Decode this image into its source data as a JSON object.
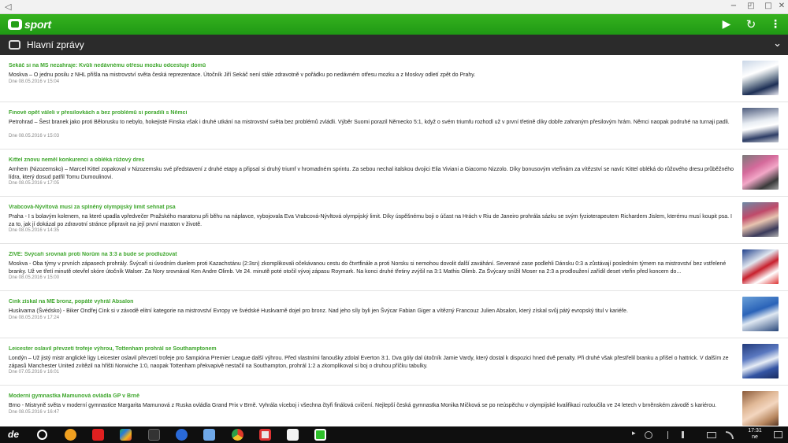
{
  "window": {
    "back": "◁",
    "minimize": "−",
    "maximize": "□",
    "restore": "◰",
    "close": "✕"
  },
  "app": {
    "logo_text": "sport",
    "play": "▶",
    "refresh": "↻",
    "menu": "⋮"
  },
  "section": {
    "title": "Hlavní zprávy",
    "chevron": "⌄"
  },
  "articles": [
    {
      "title": "Sekáč si na MS nezahraje: Kvůli nedávnému otřesu mozku odcestuje domů",
      "body": "Moskva – O jednu posilu z NHL přišla na mistrovství světa česká reprezentace. Útočník Jiří Sekáč není stále zdravotně v pořádku po nedávném otřesu mozku a z Moskvy odletí zpět do Prahy.",
      "date": "Dne 08.05.2016 v 15:04"
    },
    {
      "title": "Finové opět váleli v přesilovkách a bez problémů si poradili s Němci",
      "body": "Petrohrad – Šest branek jako proti Bělorusku to nebylo, hokejisté Finska však i druhé utkání na mistrovství světa bez problémů zvládli. Výběr Suomi porazil Německo 5:1, když o svém triumfu rozhodl už v první třetině díky dobře zahraným přesilovým hrám. Němci naopak podruhé na turnaji padli.",
      "date": "Dne 08.05.2016 v 15:03"
    },
    {
      "title": "Kittel znovu neměl konkurenci a obléká růžový dres",
      "body": "Arnhem (Nizozemsko) – Marcel Kittel zopakoval v Nizozemsku své představení z druhé etapy a připsal si druhý triumf v hromadném sprintu. Za sebou nechal italskou dvojici Elia Viviani a Giacomo Nizzolo. Díky bonusovým vteřinám za vítězství se navíc Kittel obléká do růžového dresu průběžného lídra, který dosud patřil Tomu Dumoulinovi.",
      "date": "Dne 08.05.2016 v 17:05"
    },
    {
      "title": "Vrabcová-Nývltová musí za splněný olympijský limit sehnat psa",
      "body": "Praha - I s bolavým kolenem, na které upadla vpředvečer Pražského maratonu při běhu na náplavce, vybojovala Eva Vrabcová-Nývltová olympijský limit. Díky úspěšnému boji o účast na Hrách v Riu de Janeiro prohrála sázku se svým fyzioterapeutem Richardem Jislem, kterému musí koupit psa. I za to, jak jí dokázal po zdravotní stránce připravit na její první maraton v životě.",
      "date": "Dne 08.05.2016 v 14:35"
    },
    {
      "title": "ŽIVĚ: Švýcaři srovnali proti Norům na 3:3 a bude se prodlužovat",
      "body": "Moskva - Oba týmy v prvních zápasech prohrály. Švýcaři si úvodním duelem proti Kazachstánu (2:3sn) zkomplikovali očekávanou cestu do čtvrtfinále a proti Norsku si nemohou dovolit další zaváhání. Severané zase podlehli Dánsku 0:3 a zůstávají posledním týmem na mistrovství bez vstřelené branky. Už ve třetí minutě otevřel skóre útočník Walser. Za Nory srovnával Ken Andre Olimb. Ve 24. minutě poté otočil vývoj zápasu Roymark. Na konci druhé třetiny zvýšil na 3:1 Mathis Olimb. Za Švýcary snížil Moser na 2:3 a prodloužení zařídil deset vteřin před koncem do...",
      "date": "Dne 08.05.2016 v 15:00"
    },
    {
      "title": "Cink získal na ME bronz, popáté vyhrál Absalon",
      "body": "Huskvarna (Švédsko) - Biker Ondřej Cink si v závodě elitní kategorie na mistrovství Evropy ve švédské Huskvarně dojel pro bronz. Nad jeho síly byli jen Švýcar Fabian Giger a vítězný Francouz Julien Absalon, který získal svůj pátý evropský titul v kariéře.",
      "date": "Dne 08.05.2016 v 17:24"
    },
    {
      "title": "Leicester oslavil převzetí trofeje výhrou, Tottenham prohrál se Southamptonem",
      "body": "Londýn – Už jistý mistr anglické ligy Leicester oslavil převzetí trofeje pro šampióna Premier League další výhrou. Před vlastními fanoušky zdolal Everton 3:1. Dva góly dal útočník Jamie Vardy, který dostal k dispozici hned dvě penalty. Při druhé však přestřelil branku a přišel o hattrick. V dalším ze zápasů Manchester United zvítězil na hřišti Norwiche 1:0, naopak Tottenham překvapivě nestačil na Southampton, prohrál 1:2 a zkomplikoval si boj o druhou příčku tabulky.",
      "date": "Dne 07.05.2016 v 16:01"
    },
    {
      "title": "Moderní gymnastka Mamunová ovládla GP v Brně",
      "body": "Brno - Mistryně světa v moderní gymnastice Margarita Mamunová z Ruska ovládla Grand Prix v Brně. Vyhrála víceboj i všechna čtyři finálová cvičení. Nejlepší česká gymnastka Monika Mičková se po neúspěchu v olympijské kvalifikaci rozloučila ve 24 letech v brněnském závodě s kariérou.",
      "date": "Dne 08.05.2016 v 16:47"
    }
  ],
  "taskbar": {
    "de_label": "de",
    "tray_play": "▸",
    "clock_time": "17:31",
    "clock_day": "ne"
  }
}
